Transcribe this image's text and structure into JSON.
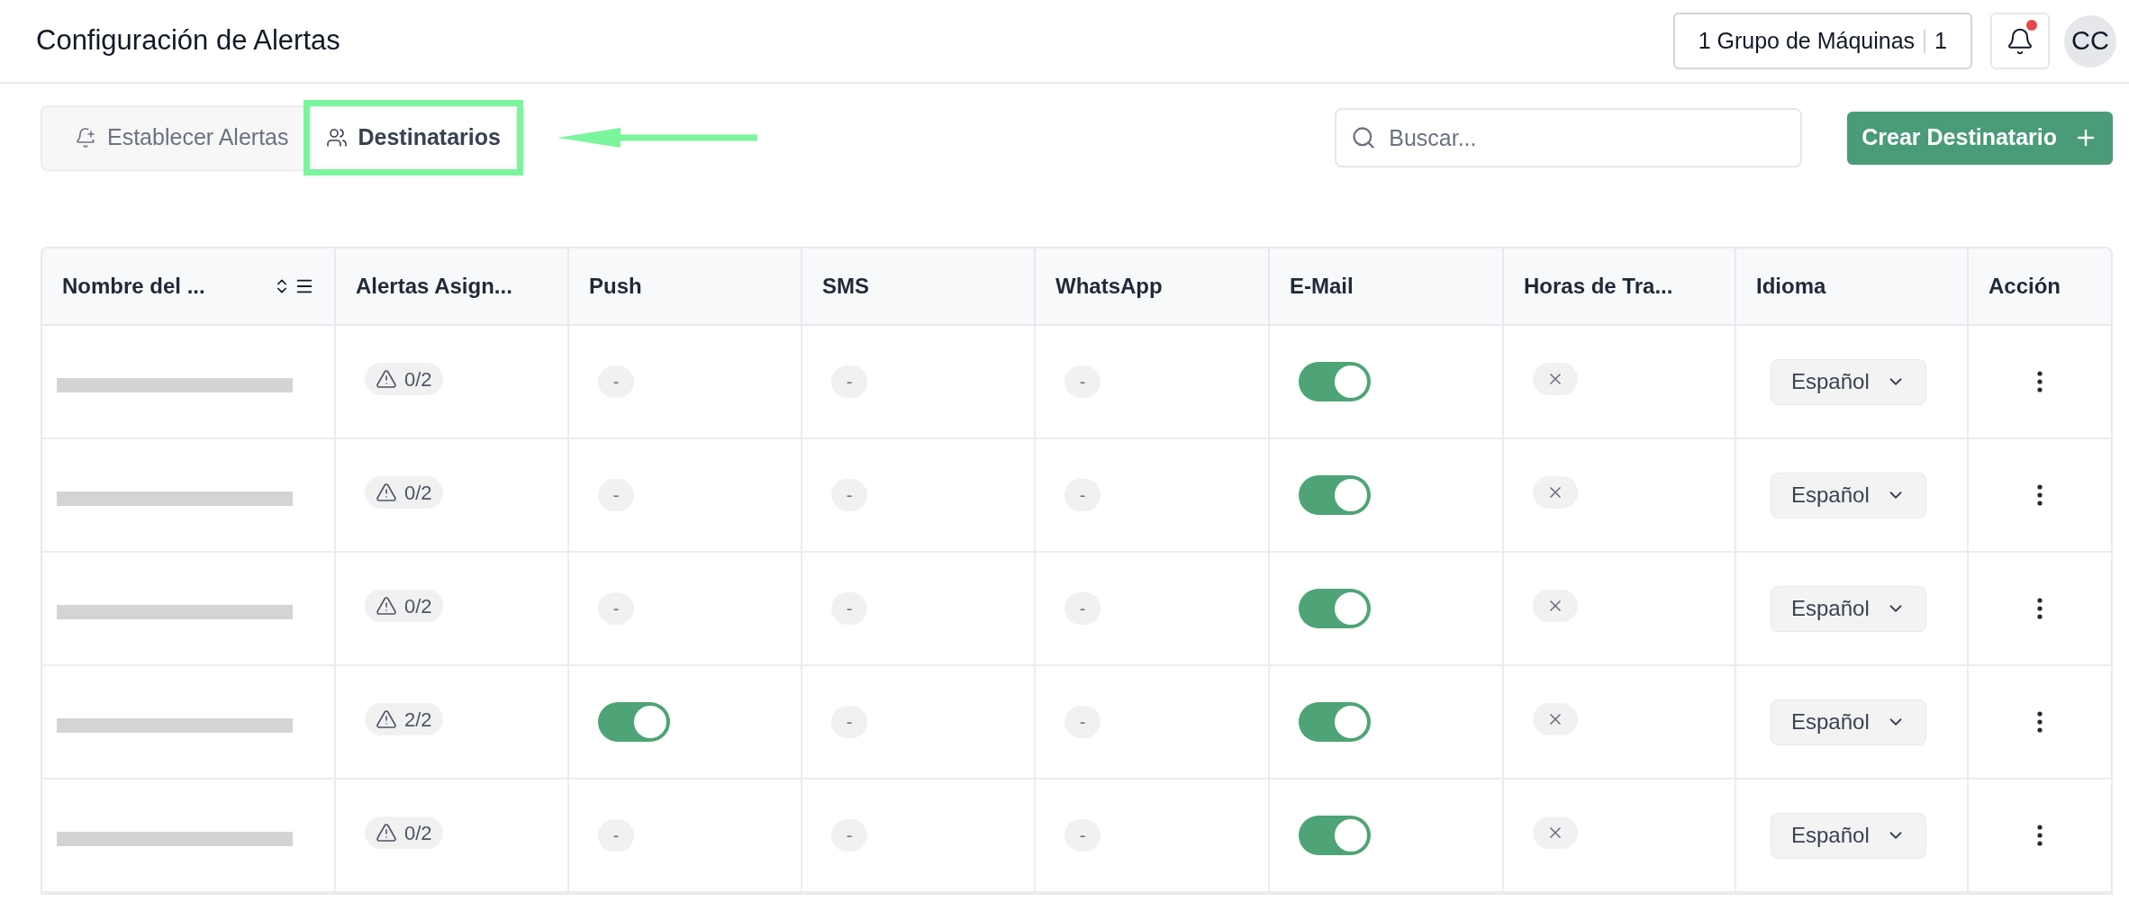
{
  "header": {
    "title": "Configuración de Alertas",
    "group_button": {
      "label": "1 Grupo de Máquinas",
      "count": "1"
    },
    "notifications": {
      "unread": true
    },
    "avatar": "CC"
  },
  "tabs": [
    {
      "label": "Establecer Alertas",
      "selected": false,
      "highlighted": false
    },
    {
      "label": "Destinatarios",
      "selected": true,
      "highlighted": true
    }
  ],
  "search": {
    "placeholder": "Buscar..."
  },
  "create_button": {
    "label": "Crear Destinatario"
  },
  "table": {
    "columns": [
      {
        "label": "Nombre del ...",
        "sortable": true
      },
      {
        "label": "Alertas Asign...",
        "sortable": false
      },
      {
        "label": "Push",
        "sortable": false
      },
      {
        "label": "SMS",
        "sortable": false
      },
      {
        "label": "WhatsApp",
        "sortable": false
      },
      {
        "label": "E-Mail",
        "sortable": false
      },
      {
        "label": "Horas de Tra...",
        "sortable": false
      },
      {
        "label": "Idioma",
        "sortable": false
      },
      {
        "label": "Acción",
        "sortable": false
      }
    ],
    "rows": [
      {
        "name_redacted": true,
        "alerts": "0/2",
        "channels": [
          {
            "kind": "empty",
            "text": "-"
          },
          {
            "kind": "empty",
            "text": "-"
          },
          {
            "kind": "empty",
            "text": "-"
          },
          {
            "kind": "toggle",
            "on": true
          }
        ],
        "work_hours": {
          "enabled": false
        },
        "language": "Español"
      },
      {
        "name_redacted": true,
        "alerts": "0/2",
        "channels": [
          {
            "kind": "empty",
            "text": "-"
          },
          {
            "kind": "empty",
            "text": "-"
          },
          {
            "kind": "empty",
            "text": "-"
          },
          {
            "kind": "toggle",
            "on": true
          }
        ],
        "work_hours": {
          "enabled": false
        },
        "language": "Español"
      },
      {
        "name_redacted": true,
        "alerts": "0/2",
        "channels": [
          {
            "kind": "empty",
            "text": "-"
          },
          {
            "kind": "empty",
            "text": "-"
          },
          {
            "kind": "empty",
            "text": "-"
          },
          {
            "kind": "toggle",
            "on": true
          }
        ],
        "work_hours": {
          "enabled": false
        },
        "language": "Español"
      },
      {
        "name_redacted": true,
        "alerts": "2/2",
        "channels": [
          {
            "kind": "toggle",
            "on": true
          },
          {
            "kind": "empty",
            "text": "-"
          },
          {
            "kind": "empty",
            "text": "-"
          },
          {
            "kind": "toggle",
            "on": true
          }
        ],
        "work_hours": {
          "enabled": false
        },
        "language": "Español"
      },
      {
        "name_redacted": true,
        "alerts": "0/2",
        "channels": [
          {
            "kind": "empty",
            "text": "-"
          },
          {
            "kind": "empty",
            "text": "-"
          },
          {
            "kind": "empty",
            "text": "-"
          },
          {
            "kind": "toggle",
            "on": true
          }
        ],
        "work_hours": {
          "enabled": false
        },
        "language": "Español"
      }
    ]
  }
}
